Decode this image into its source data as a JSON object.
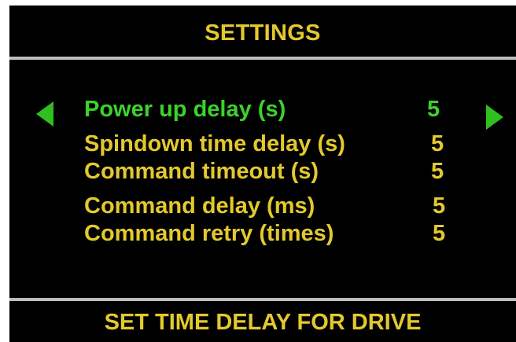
{
  "header": {
    "title": "SETTINGS"
  },
  "settings": {
    "items": [
      {
        "label": "Power up delay (s)",
        "value": "5",
        "selected": true
      },
      {
        "label": "Spindown time delay (s)",
        "value": "5",
        "selected": false
      },
      {
        "label": "Command timeout (s)",
        "value": "5",
        "selected": false
      },
      {
        "label": "Command delay (ms)",
        "value": "5",
        "selected": false
      },
      {
        "label": "Command retry (times)",
        "value": "5",
        "selected": false
      }
    ]
  },
  "nav": {
    "prev_icon": "triangle-left-icon",
    "next_icon": "triangle-right-icon"
  },
  "footer": {
    "hint": "SET TIME DELAY FOR DRIVE"
  },
  "colors": {
    "background": "#000000",
    "text": "#e3c92e",
    "selected": "#3bd22a",
    "arrow": "#2fbf1f",
    "divider": "#bdbdbd"
  }
}
